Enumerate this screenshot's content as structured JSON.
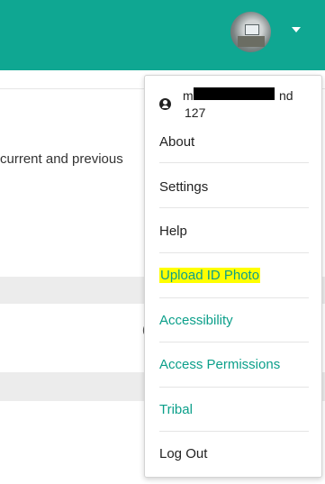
{
  "header": {
    "avatar_icon": "user-avatar",
    "dropdown_icon": "caret-down-icon",
    "brand_color": "#0fa792"
  },
  "background_page": {
    "partial_text": "current and previous",
    "partial_marker": "("
  },
  "user_menu": {
    "user": {
      "name_start": "m",
      "name_end": "nd",
      "id": "127",
      "icon": "user-circle-icon"
    },
    "items": [
      {
        "label": "About",
        "style": "default"
      },
      {
        "label": "Settings",
        "style": "default"
      },
      {
        "label": "Help",
        "style": "default"
      },
      {
        "label": "Upload ID Photo",
        "style": "highlighted",
        "highlight_color": "#ffff00"
      },
      {
        "label": "Accessibility",
        "style": "link",
        "color": "#0b9f8a"
      },
      {
        "label": "Access Permissions",
        "style": "link",
        "color": "#0b9f8a"
      },
      {
        "label": "Tribal",
        "style": "link",
        "color": "#0b9f8a"
      },
      {
        "label": "Log Out",
        "style": "default"
      }
    ]
  }
}
